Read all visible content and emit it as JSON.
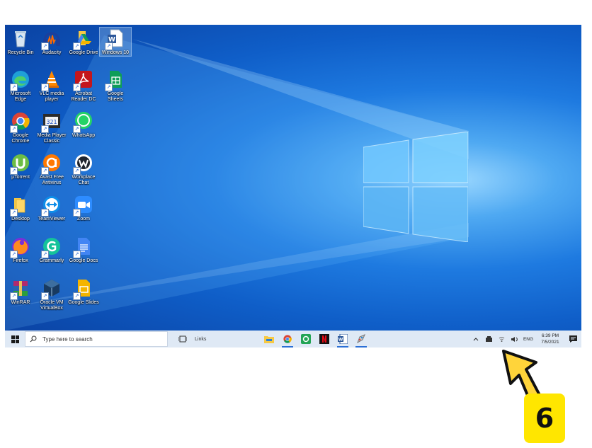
{
  "desktop_icons": [
    {
      "label": "Recycle Bin",
      "icon": "recycle-bin-icon"
    },
    {
      "label": "Audacity",
      "icon": "audacity-icon"
    },
    {
      "label": "Google Drive",
      "icon": "google-drive-icon"
    },
    {
      "label": "Windows 10",
      "icon": "word-document-icon"
    },
    {
      "label": "Microsoft Edge",
      "icon": "edge-icon"
    },
    {
      "label": "VLC media player",
      "icon": "vlc-icon"
    },
    {
      "label": "Acrobat Reader DC",
      "icon": "acrobat-icon"
    },
    {
      "label": "Google Sheets",
      "icon": "google-sheets-icon"
    },
    {
      "label": "Google Chrome",
      "icon": "chrome-icon"
    },
    {
      "label": "Media Player Classic",
      "icon": "media-player-classic-icon"
    },
    {
      "label": "WhatsApp",
      "icon": "whatsapp-icon"
    },
    {
      "label": "µTorrent",
      "icon": "utorrent-icon"
    },
    {
      "label": "Avast Free Antivirus",
      "icon": "avast-icon"
    },
    {
      "label": "Workplace Chat",
      "icon": "workplace-chat-icon"
    },
    {
      "label": "Desktop",
      "icon": "folder-icon"
    },
    {
      "label": "TeamViewer",
      "icon": "teamviewer-icon"
    },
    {
      "label": "Zoom",
      "icon": "zoom-icon"
    },
    {
      "label": "Firefox",
      "icon": "firefox-icon"
    },
    {
      "label": "Grammarly",
      "icon": "grammarly-icon"
    },
    {
      "label": "Google Docs",
      "icon": "google-docs-icon"
    },
    {
      "label": "WinRAR",
      "icon": "winrar-icon"
    },
    {
      "label": "Oracle VM VirtualBox",
      "icon": "virtualbox-icon"
    },
    {
      "label": "Google Slides",
      "icon": "google-slides-icon"
    }
  ],
  "taskbar": {
    "search_placeholder": "Type here to search",
    "links_label": "Links",
    "pinned": [
      "file-explorer-icon",
      "chrome-icon",
      "green-app-icon",
      "netflix-icon",
      "word-icon",
      "paint-icon"
    ]
  },
  "tray": {
    "language": "ENG",
    "time": "6:39 PM",
    "date": "7/5/2021"
  },
  "callout": {
    "number": "6"
  },
  "colors": {
    "accent_yellow": "#ffe600",
    "taskbar_bg": "#dfe9f5"
  }
}
